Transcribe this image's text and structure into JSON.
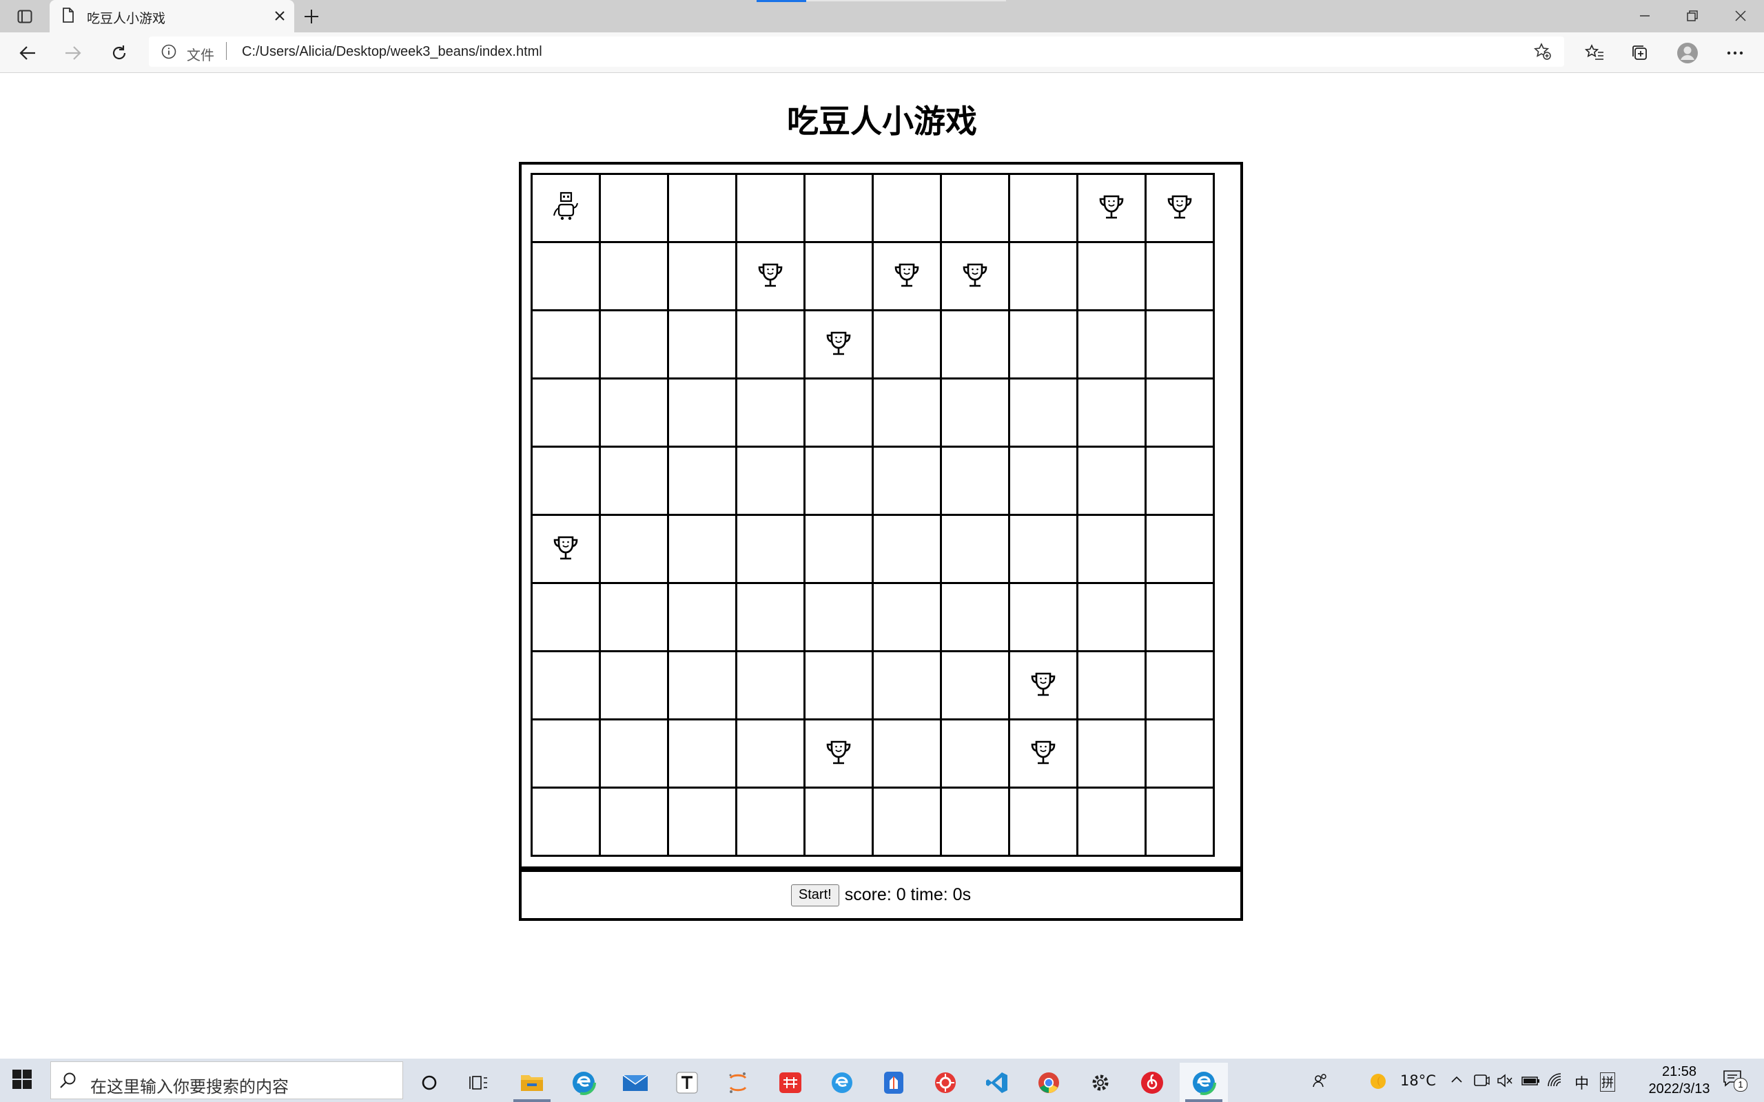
{
  "browser": {
    "tab_title": "吃豆人小游戏",
    "address_scheme": "文件",
    "address_url": "C:/Users/Alicia/Desktop/week3_beans/index.html"
  },
  "page": {
    "title": "吃豆人小游戏"
  },
  "game": {
    "rows": 10,
    "cols": 10,
    "player": {
      "row": 0,
      "col": 0,
      "icon": "robot-icon"
    },
    "beans": [
      {
        "row": 0,
        "col": 8
      },
      {
        "row": 0,
        "col": 9
      },
      {
        "row": 1,
        "col": 3
      },
      {
        "row": 1,
        "col": 5
      },
      {
        "row": 1,
        "col": 6
      },
      {
        "row": 2,
        "col": 4
      },
      {
        "row": 5,
        "col": 0
      },
      {
        "row": 7,
        "col": 7
      },
      {
        "row": 8,
        "col": 4
      },
      {
        "row": 8,
        "col": 7
      }
    ],
    "bean_icon": "trophy-icon",
    "start_label": "Start!",
    "status_text": "score: 0 time: 0s"
  },
  "taskbar": {
    "search_placeholder": "在这里输入你要搜索的内容",
    "weather": "18°C",
    "ime_mode": "中",
    "ime_extra": "拼",
    "time": "21:58",
    "date": "2022/3/13",
    "notification_count": "1",
    "apps": [
      "task-view-icon",
      "file-explorer-icon",
      "edge-icon",
      "mail-icon",
      "typora-icon",
      "jupyter-icon",
      "youdao-icon",
      "ie-icon",
      "app-icon",
      "app-red-icon",
      "vscode-icon",
      "chrome-icon",
      "settings-icon",
      "netease-music-icon",
      "edge-active-icon"
    ]
  }
}
